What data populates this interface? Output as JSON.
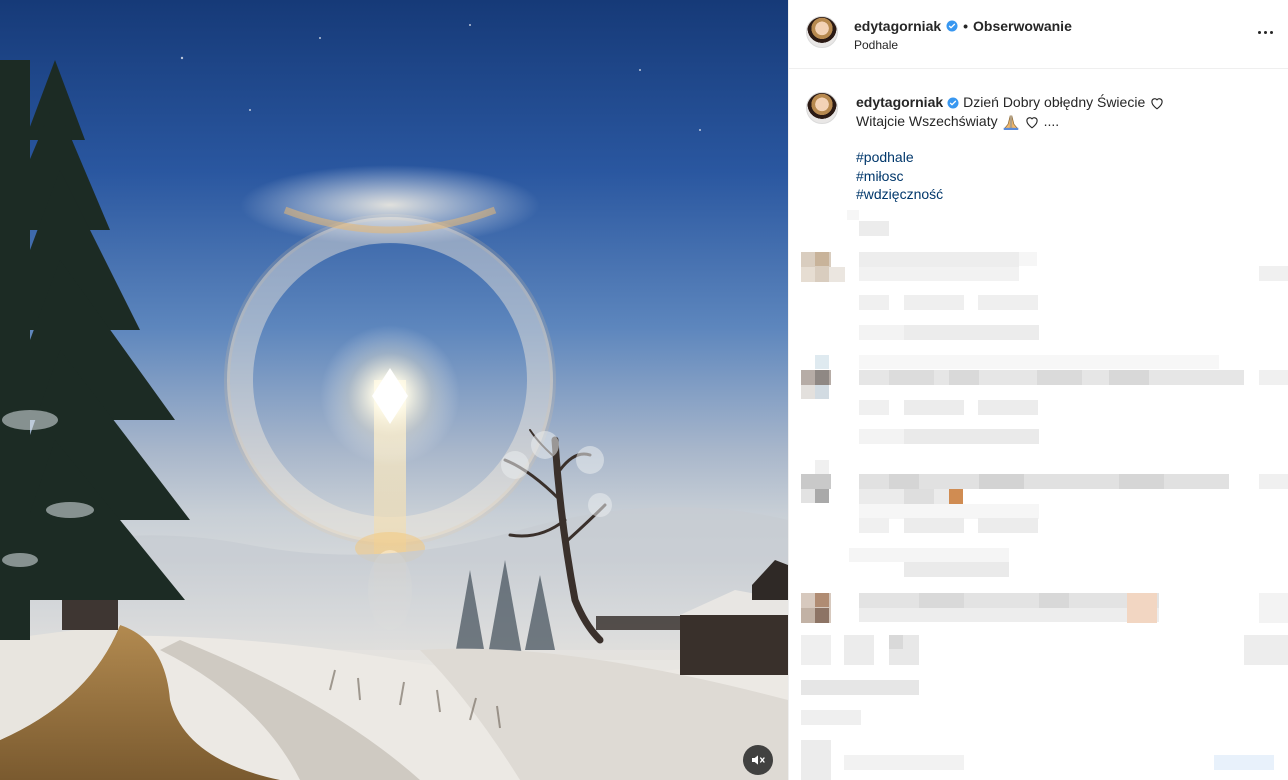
{
  "post": {
    "username": "edytagorniak",
    "follow_separator": "•",
    "follow_label": "Obserwowanie",
    "location": "Podhale",
    "caption_line1": "Dzień Dobry obłędny Świecie",
    "caption_line2": "Witajcie Wszechświaty",
    "caption_line2_suffix": "....",
    "hashtags": [
      "#podhale",
      "#miłosc",
      "#wdzięczność"
    ]
  },
  "colors": {
    "link": "#00376b",
    "verified": "#3897f0",
    "text": "#262626",
    "divider": "#efefef"
  },
  "icons": {
    "verified": "verified-badge-icon",
    "more": "more-options-icon",
    "heart": "heart-outline-icon",
    "pray": "folded-hands-emoji",
    "mute": "volume-muted-icon"
  }
}
